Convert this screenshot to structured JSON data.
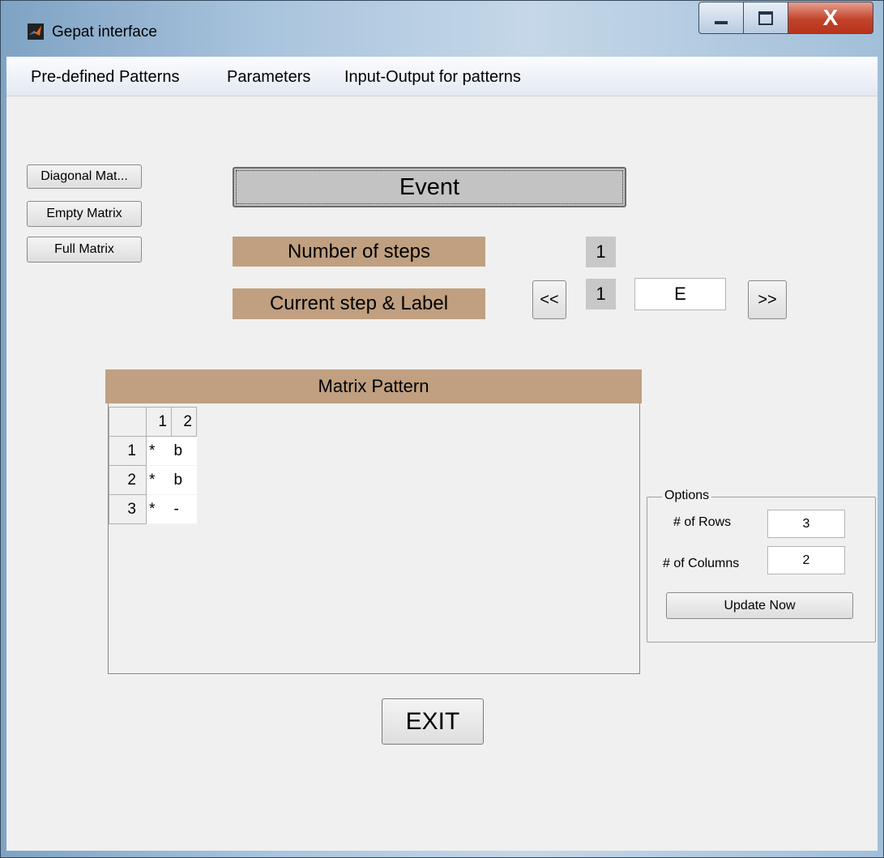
{
  "window": {
    "title": "Gepat interface",
    "minimize_label": "",
    "close_glyph": "X"
  },
  "menu": [
    "Pre-defined Patterns",
    "Parameters",
    "Input-Output for patterns"
  ],
  "left_buttons": {
    "diagonal": "Diagonal Mat...",
    "empty": "Empty Matrix",
    "full": "Full Matrix"
  },
  "event_button": "Event",
  "steps": {
    "number_label": "Number of steps",
    "number_value": "1",
    "current_label": "Current step & Label",
    "current_value": "1",
    "label_value": "E",
    "prev": "<<",
    "next": ">>"
  },
  "matrix": {
    "title": "Matrix Pattern",
    "column_headers": [
      "1",
      "2"
    ],
    "rows": [
      {
        "header": "1",
        "cells": [
          "*",
          "b"
        ]
      },
      {
        "header": "2",
        "cells": [
          "*",
          "b"
        ]
      },
      {
        "header": "3",
        "cells": [
          "*",
          "-"
        ]
      }
    ]
  },
  "options": {
    "title": "Options",
    "rows_label": "# of Rows",
    "rows_value": "3",
    "cols_label": "# of Columns",
    "cols_value": "2",
    "update_button": "Update Now"
  },
  "exit_button": "EXIT",
  "colors": {
    "label_bg": "#c0a080",
    "number_bg": "#c8c8c8",
    "client_bg": "#f0f0f0",
    "close_button": "#c2432b"
  },
  "icons": {
    "app": "matlab-logo-icon",
    "minimize": "minimize-icon",
    "maximize": "maximize-icon",
    "close": "close-icon"
  }
}
